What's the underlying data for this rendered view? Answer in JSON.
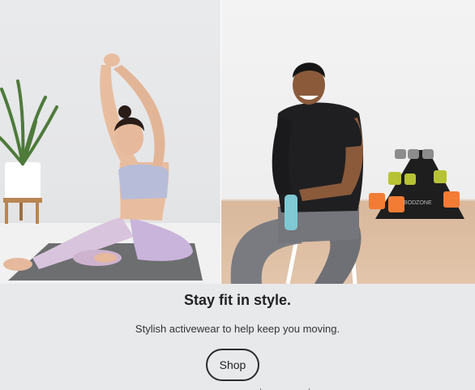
{
  "promo": {
    "headline": "Stay fit in style.",
    "subtext": "Stylish activewear to help keep you moving.",
    "button_label": "Shop"
  },
  "images": {
    "left": "woman-yoga-stretch-photo",
    "right": "man-seated-with-dumbbells-photo",
    "dumbbell_brand": "BODZONE"
  },
  "colors": {
    "background": "#e8e9eb",
    "text": "#222222",
    "button_border": "#2b2b2b"
  }
}
